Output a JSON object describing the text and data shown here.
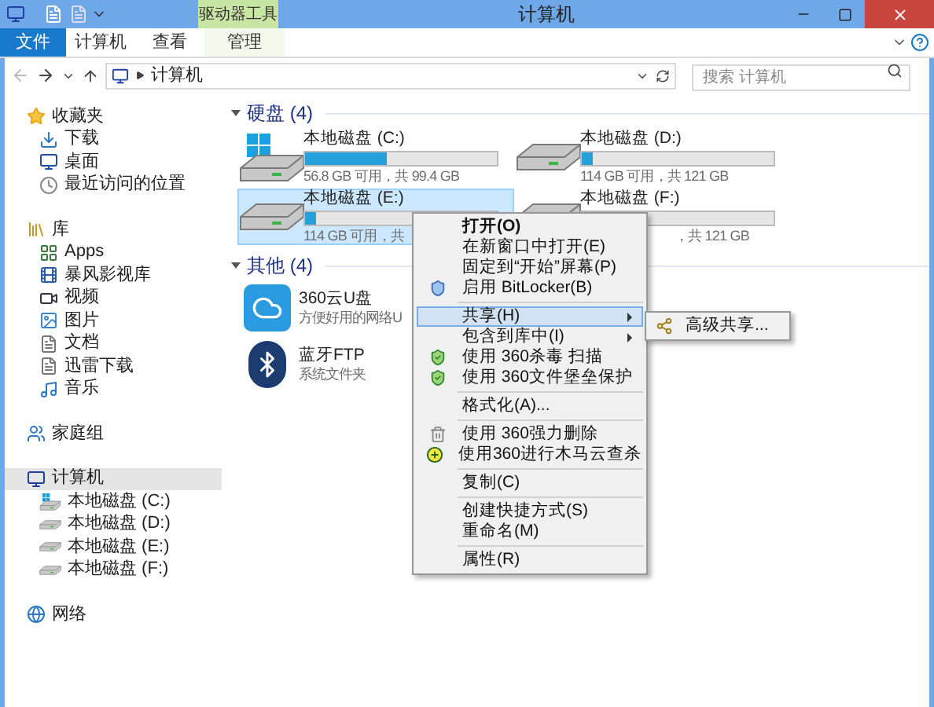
{
  "window": {
    "title": "计算机"
  },
  "ribbon": {
    "tool_group": "驱动器工具",
    "tabs": [
      {
        "label": "文件",
        "kind": "file",
        "selected": false
      },
      {
        "label": "计算机",
        "kind": "tab",
        "selected": false
      },
      {
        "label": "查看",
        "kind": "tab",
        "selected": false
      },
      {
        "label": "管理",
        "kind": "tool",
        "selected": false
      }
    ]
  },
  "address": {
    "path": "计算机",
    "search_placeholder": "搜索 计算机"
  },
  "sidebar": {
    "groups": [
      {
        "label": "收藏夹",
        "selected": false,
        "children": [
          {
            "label": "下载",
            "selected": false
          },
          {
            "label": "桌面",
            "selected": false
          },
          {
            "label": "最近访问的位置",
            "selected": false
          }
        ]
      },
      {
        "label": "库",
        "selected": false,
        "children": [
          {
            "label": "Apps",
            "selected": false
          },
          {
            "label": "暴风影视库",
            "selected": false
          },
          {
            "label": "视频",
            "selected": false
          },
          {
            "label": "图片",
            "selected": false
          },
          {
            "label": "文档",
            "selected": false
          },
          {
            "label": "迅雷下载",
            "selected": false
          },
          {
            "label": "音乐",
            "selected": false
          }
        ]
      },
      {
        "label": "家庭组",
        "selected": false
      },
      {
        "label": "计算机",
        "selected": true,
        "children": [
          {
            "label": "本地磁盘 (C:)",
            "selected": false
          },
          {
            "label": "本地磁盘 (D:)",
            "selected": false
          },
          {
            "label": "本地磁盘 (E:)",
            "selected": false
          },
          {
            "label": "本地磁盘 (F:)",
            "selected": false
          }
        ]
      },
      {
        "label": "网络",
        "selected": false
      }
    ]
  },
  "sections": [
    {
      "title": "硬盘 (4)",
      "items": [
        {
          "kind": "drive",
          "name": "本地磁盘 (C:)",
          "system": true,
          "level": 0.43,
          "detail": "56.8 GB 可用，共 99.4 GB",
          "selected": false
        },
        {
          "kind": "drive",
          "name": "本地磁盘 (D:)",
          "system": false,
          "level": 0.06,
          "detail": "114 GB 可用，共 121 GB",
          "selected": false
        },
        {
          "kind": "drive",
          "name": "本地磁盘 (E:)",
          "system": false,
          "level": 0.06,
          "detail": "114 GB 可用，共",
          "selected": true
        },
        {
          "kind": "drive",
          "name": "本地磁盘 (F:)",
          "system": false,
          "detail": "，共 121 GB",
          "selected": false
        }
      ]
    },
    {
      "title": "其他 (4)",
      "items": [
        {
          "kind": "cloud",
          "name": "360云U盘",
          "detail": "方便好用的网络U",
          "selected": false
        },
        {
          "kind": "bluetooth",
          "name": "蓝牙FTP",
          "detail": "系统文件夹",
          "selected": false
        }
      ]
    }
  ],
  "context_menu": {
    "items": [
      {
        "kind": "item",
        "label": "打开(O)",
        "bold": true,
        "selected": false
      },
      {
        "kind": "item",
        "label": "在新窗口中打开(E)",
        "selected": false
      },
      {
        "kind": "item",
        "label": "固定到“开始”屏幕(P)",
        "selected": false
      },
      {
        "kind": "item",
        "label": "启用 BitLocker(B)",
        "selected": false
      },
      {
        "kind": "separator"
      },
      {
        "kind": "item",
        "label": "共享(H)",
        "submenu": true,
        "selected": true
      },
      {
        "kind": "item",
        "label": "包含到库中(I)",
        "submenu": true,
        "selected": false
      },
      {
        "kind": "item",
        "label": "使用 360杀毒 扫描",
        "selected": false
      },
      {
        "kind": "item",
        "label": "使用 360文件堡垒保护",
        "selected": false
      },
      {
        "kind": "separator"
      },
      {
        "kind": "item",
        "label": "格式化(A)...",
        "selected": false
      },
      {
        "kind": "separator"
      },
      {
        "kind": "item",
        "label": "使用 360强力删除",
        "selected": false
      },
      {
        "kind": "item",
        "label": "使用360进行木马云查杀",
        "selected": false
      },
      {
        "kind": "separator"
      },
      {
        "kind": "item",
        "label": "复制(C)",
        "selected": false
      },
      {
        "kind": "separator"
      },
      {
        "kind": "item",
        "label": "创建快捷方式(S)",
        "selected": false
      },
      {
        "kind": "item",
        "label": "重命名(M)",
        "selected": false
      },
      {
        "kind": "separator"
      },
      {
        "kind": "item",
        "label": "属性(R)",
        "selected": false
      }
    ]
  },
  "submenu": {
    "items": [
      {
        "label": "高级共享..."
      }
    ]
  }
}
